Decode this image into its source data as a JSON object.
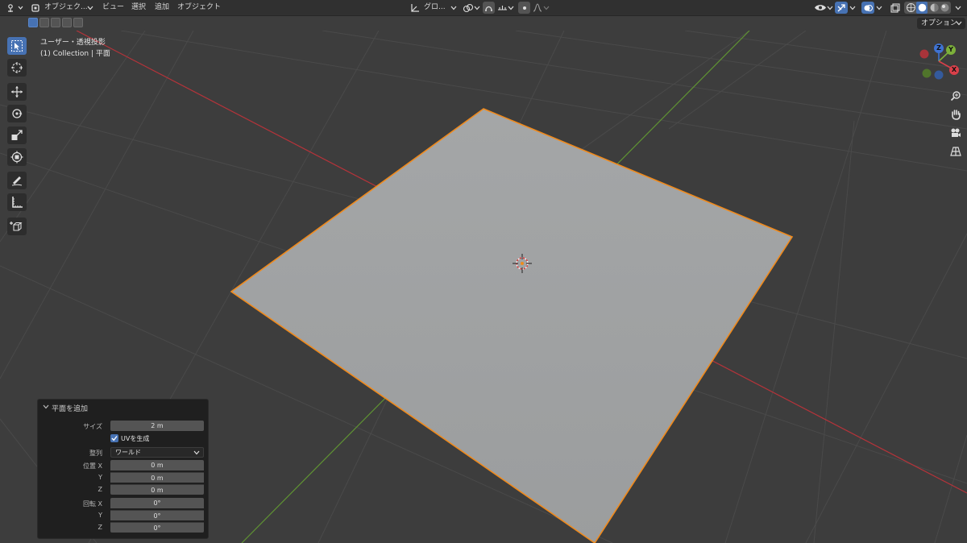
{
  "header": {
    "editor_icon": "editor-type-icon",
    "mode_label": "オブジェク...",
    "menus": [
      "ビュー",
      "選択",
      "追加",
      "オブジェクト"
    ],
    "transform_orientation": "グロ..."
  },
  "overlay": {
    "view_name": "ユーザー・透視投影",
    "collection_info": "(1) Collection | 平面",
    "options_label": "オプション"
  },
  "gizmo": {
    "z_label": "Z",
    "y_label": "Y",
    "x_label": "X",
    "colors": {
      "x": "#d9404a",
      "y": "#7cb03a",
      "z": "#3f73d3"
    }
  },
  "toolbar": {
    "tools": [
      "select-box",
      "cursor",
      "move",
      "rotate",
      "scale",
      "transform",
      "annotate",
      "measure",
      "add-cube"
    ]
  },
  "operator_panel": {
    "title": "平面を追加",
    "size_label": "サイズ",
    "size_value": "2 m",
    "uv_label": "UVを生成",
    "uv_checked": true,
    "align_label": "整列",
    "align_value": "ワールド",
    "location_label": "位置 X",
    "loc_y_label": "Y",
    "loc_z_label": "Z",
    "loc_x": "0 m",
    "loc_y": "0 m",
    "loc_z": "0 m",
    "rotation_label": "回転 X",
    "rot_y_label": "Y",
    "rot_z_label": "Z",
    "rot_x": "0°",
    "rot_y": "0°",
    "rot_z": "0°"
  },
  "colors": {
    "selection_outline": "#f08a1c",
    "plane_fill": "#9ea0a1",
    "axis_x": "#b5333a",
    "axis_y": "#5f9233"
  }
}
